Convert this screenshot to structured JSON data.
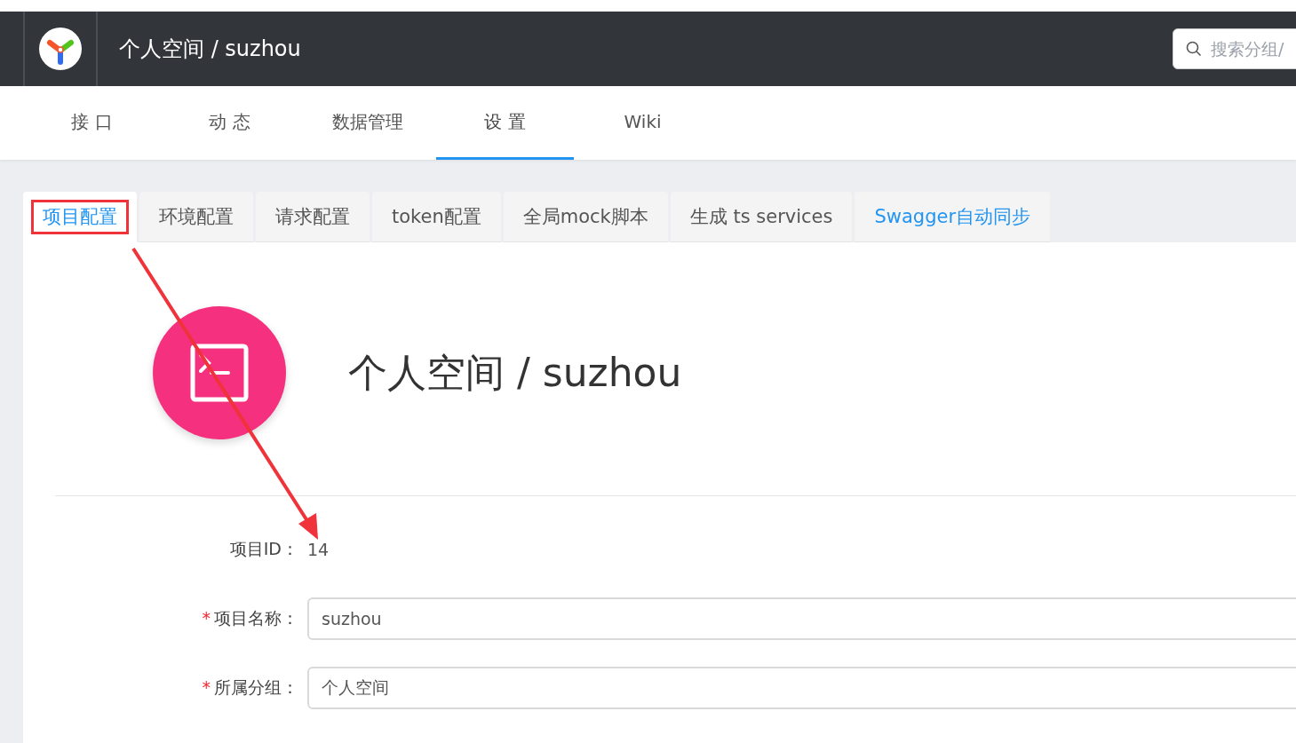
{
  "header": {
    "title": "个人空间 / suzhou",
    "search": {
      "placeholder": "搜索分组/"
    }
  },
  "nav": [
    {
      "label": "接 口",
      "selected": false
    },
    {
      "label": "动 态",
      "selected": false
    },
    {
      "label": "数据管理",
      "selected": false
    },
    {
      "label": "设 置",
      "selected": true
    },
    {
      "label": "Wiki",
      "selected": false
    }
  ],
  "settings_tabs": [
    {
      "label": "项目配置",
      "selected": true,
      "highlighted": true,
      "kind": "tab"
    },
    {
      "label": "环境配置",
      "selected": false,
      "highlighted": false,
      "kind": "tab"
    },
    {
      "label": "请求配置",
      "selected": false,
      "highlighted": false,
      "kind": "tab"
    },
    {
      "label": "token配置",
      "selected": false,
      "highlighted": false,
      "kind": "tab"
    },
    {
      "label": "全局mock脚本",
      "selected": false,
      "highlighted": false,
      "kind": "tab"
    },
    {
      "label": "生成 ts services",
      "selected": false,
      "highlighted": false,
      "kind": "tab"
    },
    {
      "label": "Swagger自动同步",
      "selected": false,
      "highlighted": false,
      "kind": "link"
    }
  ],
  "project": {
    "title": "个人空间 / suzhou",
    "id_label": "项目ID：",
    "id": "14",
    "fields": [
      {
        "label": "项目名称：",
        "required_mark": "*",
        "value": "suzhou"
      },
      {
        "label": "所属分组：",
        "required_mark": "*",
        "value": "个人空间"
      }
    ]
  },
  "annotation": {
    "arrow": true
  }
}
